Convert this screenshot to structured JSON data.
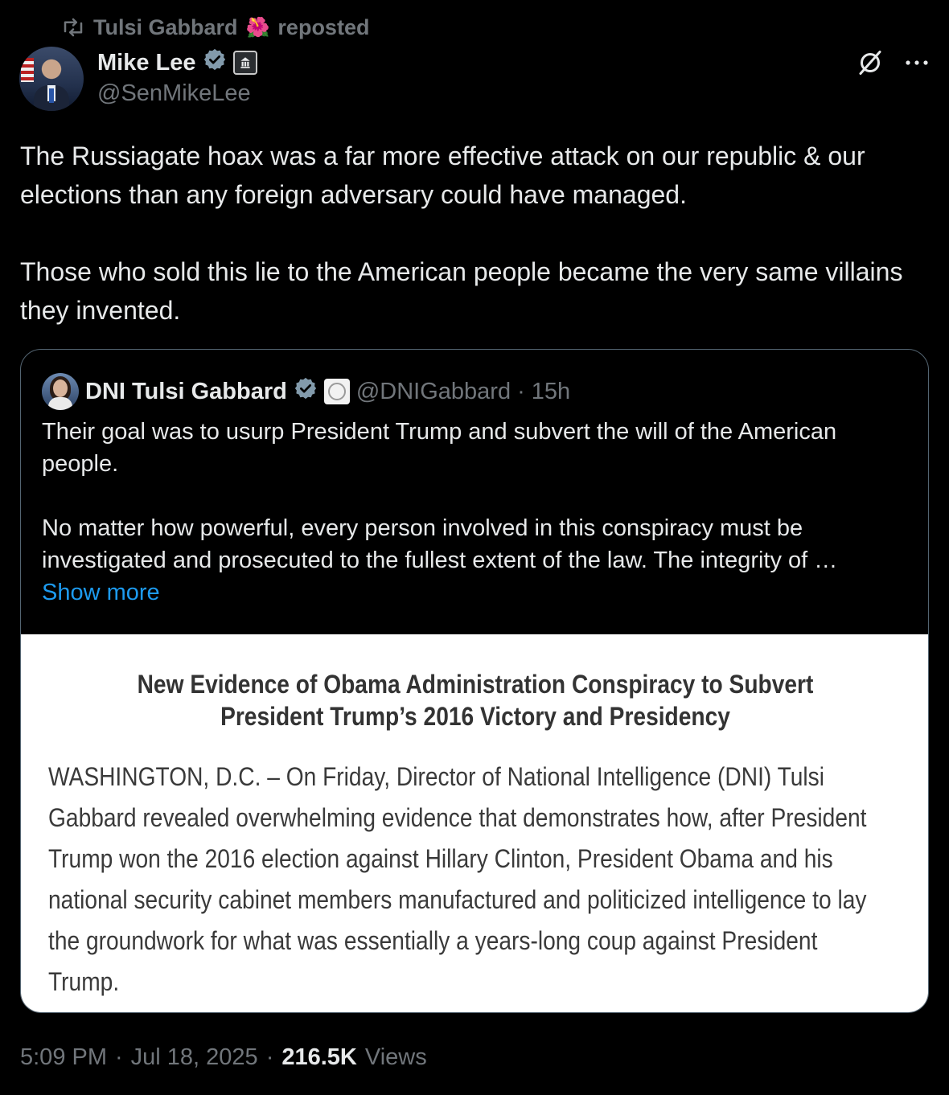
{
  "repost": {
    "reposter_name": "Tulsi Gabbard",
    "reposter_emoji": "🌺",
    "label": "reposted"
  },
  "author": {
    "name": "Mike Lee",
    "handle": "@SenMikeLee"
  },
  "tweet": {
    "paragraphs": [
      "The Russiagate hoax was a far more effective attack on our republic & our elections than any foreign adversary could have managed.",
      "Those who sold this lie to the American people became the very same villains they invented."
    ]
  },
  "quote": {
    "name": "DNI Tulsi Gabbard",
    "handle": "@DNIGabbard",
    "separator": "·",
    "time": "15h",
    "paragraphs": [
      "Their goal was to usurp President Trump and subvert the will of the American people.",
      "No matter how powerful, every person involved in this conspiracy must be investigated and prosecuted to the fullest extent of the law. The integrity of …"
    ],
    "show_more": "Show more",
    "image": {
      "title": "New Evidence of Obama Administration Conspiracy to Subvert President Trump’s 2016 Victory and Presidency",
      "body": "WASHINGTON, D.C. – On Friday, Director of National Intelligence (DNI) Tulsi Gabbard revealed overwhelming evidence that demonstrates how, after President Trump won the 2016 election against Hillary Clinton, President Obama and his national security cabinet members manufactured and politicized intelligence to lay the groundwork for what was essentially a years-long coup against President Trump."
    }
  },
  "footer": {
    "time": "5:09 PM",
    "sep1": "·",
    "date": "Jul 18, 2025",
    "sep2": "·",
    "views_count": "216.5K",
    "views_label": "Views"
  },
  "icons": {
    "repost": "repost-icon",
    "verified": "verified-badge-icon",
    "government": "government-badge-icon",
    "grok": "grok-icon",
    "more": "more-options-icon"
  },
  "colors": {
    "background": "#000000",
    "text": "#e7e9ea",
    "muted": "#71767b",
    "link": "#1d9bf0",
    "border": "#536471"
  }
}
